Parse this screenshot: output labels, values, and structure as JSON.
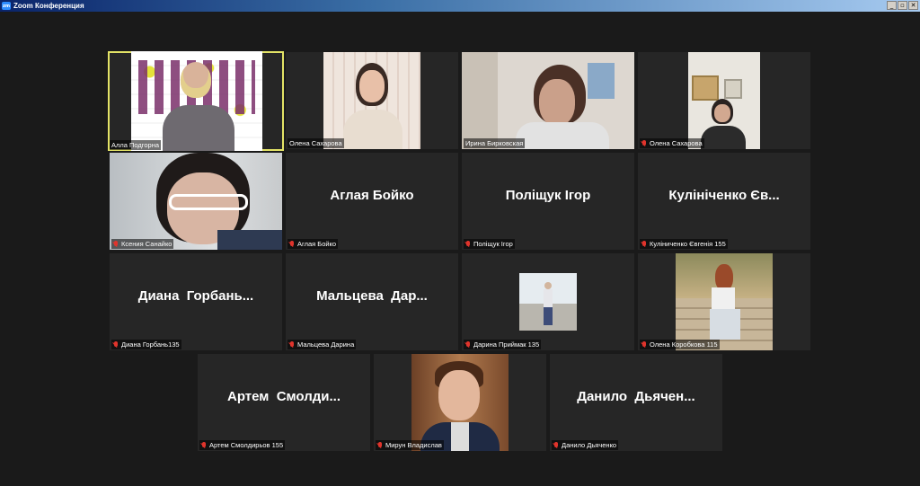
{
  "window": {
    "title": "Zoom Конференция",
    "app_icon": "zoom",
    "buttons": [
      "_",
      "▫",
      "✕"
    ]
  },
  "participants": [
    {
      "label": "Алла Подгорна",
      "display": "",
      "video": true,
      "active_speaker": true,
      "muted": false
    },
    {
      "label": "Олена Сахарова",
      "display": "",
      "video": true,
      "muted": false
    },
    {
      "label": "Ирина Бирковская",
      "display": "",
      "video": true,
      "muted": false
    },
    {
      "label": "Олена Сахарова",
      "display": "",
      "video": true,
      "muted": true
    },
    {
      "label": "Ксения Санайко",
      "display": "",
      "video": true,
      "muted": true
    },
    {
      "label": "Аглая Бойко",
      "display": "Аглая Бойко",
      "video": false,
      "muted": true
    },
    {
      "label": "Поліщук Ігор",
      "display": "Поліщук Ігор",
      "video": false,
      "muted": true
    },
    {
      "label": "Куліниченко Євгенія 155",
      "display": "Кулініченко Єв...",
      "video": false,
      "muted": true
    },
    {
      "label": "Диана Горбань135",
      "display": "Диана  Горбань...",
      "video": false,
      "muted": true
    },
    {
      "label": "Мальцева Дарина",
      "display": "Мальцева  Дар...",
      "video": false,
      "muted": true
    },
    {
      "label": "Дарина Приймак 135",
      "display": "",
      "video": true,
      "muted": true
    },
    {
      "label": "Олена Коробкова 115",
      "display": "",
      "video": true,
      "muted": true
    },
    {
      "label": "Артем Смолдирьов 155",
      "display": "Артем  Смолди...",
      "video": false,
      "muted": true
    },
    {
      "label": "Мирун Владислав",
      "display": "",
      "video": true,
      "muted": true
    },
    {
      "label": "Данило Дьяченко",
      "display": "Данило  Дьячен...",
      "video": false,
      "muted": true
    }
  ],
  "colors": {
    "background": "#1a1a1a",
    "tile": "#262626",
    "active_border": "#e3e366",
    "muted_icon": "#e0342c"
  }
}
